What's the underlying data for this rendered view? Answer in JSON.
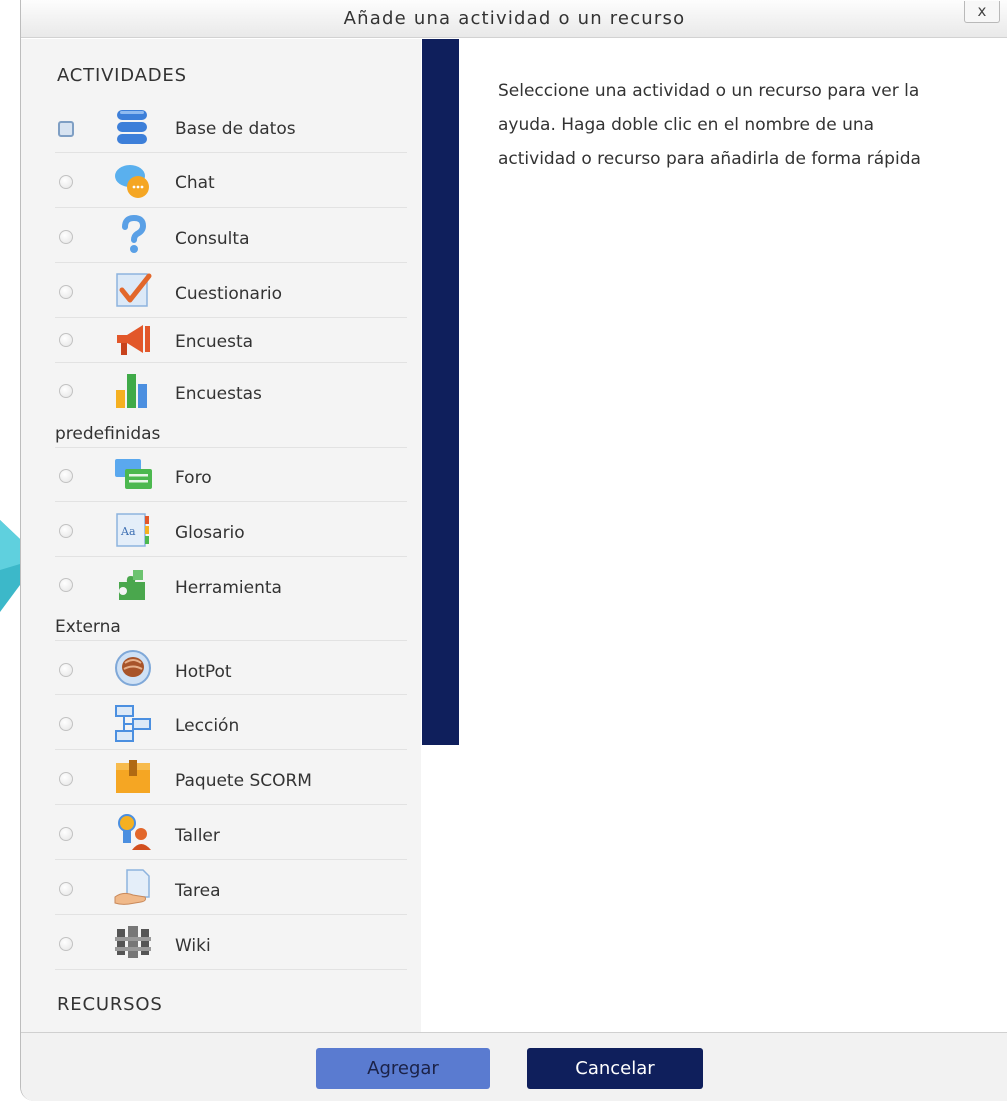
{
  "dialog": {
    "title": "Añade una actividad o un recurso",
    "close_label": "x"
  },
  "left_panel": {
    "activities_heading": "ACTIVIDADES",
    "resources_heading": "RECURSOS",
    "options": [
      {
        "label": "Base de datos",
        "icon": "database-icon",
        "selected": true
      },
      {
        "label": "Chat",
        "icon": "chat-icon",
        "selected": false
      },
      {
        "label": "Consulta",
        "icon": "question-icon",
        "selected": false
      },
      {
        "label": "Cuestionario",
        "icon": "quiz-icon",
        "selected": false
      },
      {
        "label": "Encuesta",
        "icon": "megaphone-icon",
        "selected": false
      },
      {
        "label": "Encuestas",
        "label_cont": "predefinidas",
        "icon": "bar-chart-icon",
        "selected": false
      },
      {
        "label": "Foro",
        "icon": "forum-icon",
        "selected": false
      },
      {
        "label": "Glosario",
        "icon": "glossary-icon",
        "selected": false
      },
      {
        "label": "Herramienta",
        "label_cont": "Externa",
        "icon": "puzzle-icon",
        "selected": false
      },
      {
        "label": "HotPot",
        "icon": "hotpot-icon",
        "selected": false
      },
      {
        "label": "Lección",
        "icon": "lesson-icon",
        "selected": false
      },
      {
        "label": "Paquete SCORM",
        "icon": "package-icon",
        "selected": false
      },
      {
        "label": "Taller",
        "icon": "workshop-icon",
        "selected": false
      },
      {
        "label": "Tarea",
        "icon": "assignment-icon",
        "selected": false
      },
      {
        "label": "Wiki",
        "icon": "wiki-icon",
        "selected": false
      }
    ]
  },
  "help": {
    "text": "Seleccione una actividad o un recurso para ver la ayuda. Haga doble clic en el nombre de una actividad o recurso para añadirla de forma rápida"
  },
  "footer": {
    "add_label": "Agregar",
    "cancel_label": "Cancelar"
  },
  "colors": {
    "accent_dark": "#0f1f5c",
    "accent_button": "#5a7bd0",
    "arrow": "#37b6c8"
  }
}
